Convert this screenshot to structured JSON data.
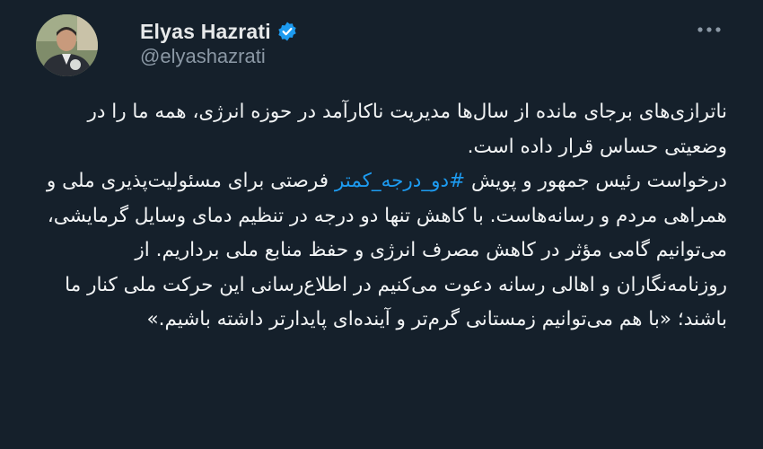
{
  "author": {
    "display_name": "Elyas Hazrati",
    "handle": "@elyashazrati",
    "verified_icon": "verified-badge-icon",
    "avatar": "profile-photo"
  },
  "menu": {
    "icon": "more-options-icon"
  },
  "tweet": {
    "paragraph1": "ناترازی‌های برجای مانده از سال‌ها مدیریت ناکارآمد در حوزه انرژی، همه ما را در وضعیتی حساس قرار داده است.",
    "paragraph2_before_hashtag": "درخواست رئیس جمهور و پویش ",
    "hashtag": "#دو_درجه_کمتر",
    "paragraph2_after_hashtag": " فرصتی برای مسئولیت‌پذیری ملی و همراهی مردم و رسانه‌هاست. با کاهش تنها دو درجه در تنظیم دمای وسایل گرمایشی، می‌توانیم گامی مؤثر در کاهش مصرف انرژی و حفظ منابع ملی برداریم. از روزنامه‌نگاران و اهالی رسانه دعوت می‌کنیم در اطلاع‌رسانی این حرکت ملی کنار ما باشند؛ «با هم می‌توانیم زمستانی گرم‌تر و آینده‌ای پایدارتر داشته باشیم.»"
  },
  "colors": {
    "background": "#15202b",
    "text": "#f2f4f5",
    "secondary_text": "#8b98a5",
    "link": "#1d9bf0"
  }
}
